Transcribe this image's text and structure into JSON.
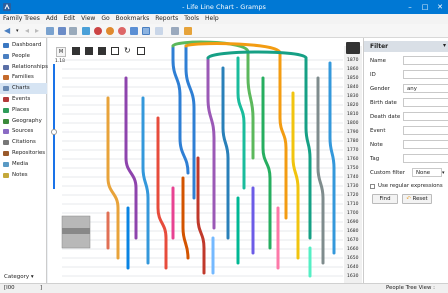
{
  "window": {
    "title": "- Life Line Chart - Gramps",
    "app_icon": "gramps-icon"
  },
  "menu": [
    "Family Trees",
    "Add",
    "Edit",
    "View",
    "Go",
    "Bookmarks",
    "Reports",
    "Tools",
    "Help"
  ],
  "sidebar": {
    "items": [
      {
        "label": "Dashboard",
        "icon": "dashboard-icon",
        "color": "#3a78c2"
      },
      {
        "label": "People",
        "icon": "people-icon",
        "color": "#4a7fc1"
      },
      {
        "label": "Relationships",
        "icon": "relationships-icon",
        "color": "#5a6fa6"
      },
      {
        "label": "Families",
        "icon": "families-icon",
        "color": "#c46a2b"
      },
      {
        "label": "Charts",
        "icon": "charts-icon",
        "color": "#6a8ab3",
        "selected": true
      },
      {
        "label": "Events",
        "icon": "events-icon",
        "color": "#b33a3a"
      },
      {
        "label": "Places",
        "icon": "places-icon",
        "color": "#2f9c5a"
      },
      {
        "label": "Geography",
        "icon": "geography-icon",
        "color": "#3b8a3b"
      },
      {
        "label": "Sources",
        "icon": "sources-icon",
        "color": "#8a6ac4"
      },
      {
        "label": "Citations",
        "icon": "citations-icon",
        "color": "#777777"
      },
      {
        "label": "Repositories",
        "icon": "repositories-icon",
        "color": "#9a5a2b"
      },
      {
        "label": "Media",
        "icon": "media-icon",
        "color": "#5a9ac4"
      },
      {
        "label": "Notes",
        "icon": "notes-icon",
        "color": "#c4a83a"
      }
    ],
    "category_label": "Category"
  },
  "chart": {
    "zoom_label": "1.18",
    "years": [
      "1870",
      "1860",
      "1850",
      "1840",
      "1830",
      "1820",
      "1810",
      "1800",
      "1790",
      "1780",
      "1770",
      "1760",
      "1750",
      "1740",
      "1730",
      "1720",
      "1710",
      "1700",
      "1690",
      "1680",
      "1670",
      "1660",
      "1650",
      "1640",
      "1630"
    ]
  },
  "filter": {
    "title": "Filter",
    "fields": [
      {
        "label": "Name",
        "value": ""
      },
      {
        "label": "ID",
        "value": ""
      },
      {
        "label": "Gender",
        "value": "any"
      },
      {
        "label": "Birth date",
        "value": ""
      },
      {
        "label": "Death date",
        "value": ""
      },
      {
        "label": "Event",
        "value": ""
      },
      {
        "label": "Note",
        "value": ""
      },
      {
        "label": "Tag",
        "value": ""
      },
      {
        "label": "Custom filter",
        "value": "None"
      }
    ],
    "regex_label": "Use regular expressions",
    "find_label": "Find",
    "reset_label": "Reset"
  },
  "status": {
    "left": "[I00",
    "left2": "]",
    "right": "People Tree View :"
  }
}
